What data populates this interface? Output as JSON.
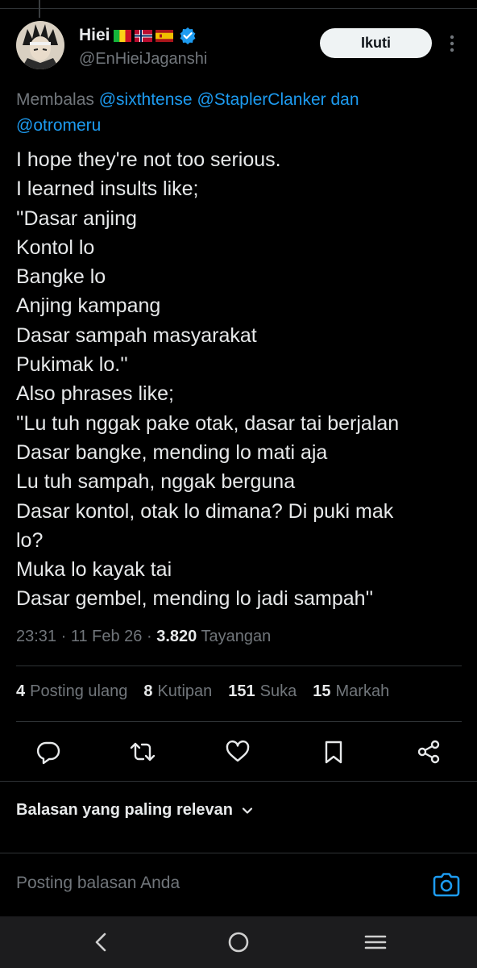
{
  "tweet": {
    "display_name": "Hiei",
    "flags": [
      "mali-flag-icon",
      "norway-flag-icon",
      "spain-flag-icon"
    ],
    "handle": "@EnHieiJaganshi",
    "follow_label": "Ikuti",
    "reply_prefix": "Membalas",
    "reply_mentions": [
      "@sixthtense",
      "@StaplerClanker"
    ],
    "reply_and": "dan",
    "reply_last_mention": "@otromeru",
    "lines": [
      "I hope they're not too serious.",
      "I learned insults like;",
      "''Dasar anjing",
      "Kontol lo",
      "Bangke lo",
      "Anjing kampang",
      "Dasar sampah masyarakat",
      "Pukimak lo.''",
      "Also phrases like;",
      "''Lu tuh nggak pake otak, dasar tai berjalan",
      "Dasar bangke, mending lo mati aja",
      "Lu tuh sampah, nggak berguna",
      "Dasar kontol, otak lo dimana? Di puki mak",
      "lo?",
      "Muka lo kayak tai",
      "Dasar gembel, mending lo jadi sampah''"
    ],
    "time": "23:31",
    "date": "11 Feb 26",
    "views_count": "3.820",
    "views_label": "Tayangan",
    "stats": [
      {
        "count": "4",
        "label": "Posting ulang"
      },
      {
        "count": "8",
        "label": "Kutipan"
      },
      {
        "count": "151",
        "label": "Suka"
      },
      {
        "count": "15",
        "label": "Markah"
      }
    ]
  },
  "actions": [
    "reply-icon",
    "repost-icon",
    "like-icon",
    "bookmark-icon",
    "share-icon"
  ],
  "sort_label": "Balasan yang paling relevan",
  "reply_input": {
    "placeholder": "Posting balasan Anda"
  },
  "colors": {
    "background": "#000000",
    "text": "#e7e9ea",
    "muted": "#71767b",
    "accent": "#1d9bf0",
    "divider": "#2f3336"
  }
}
